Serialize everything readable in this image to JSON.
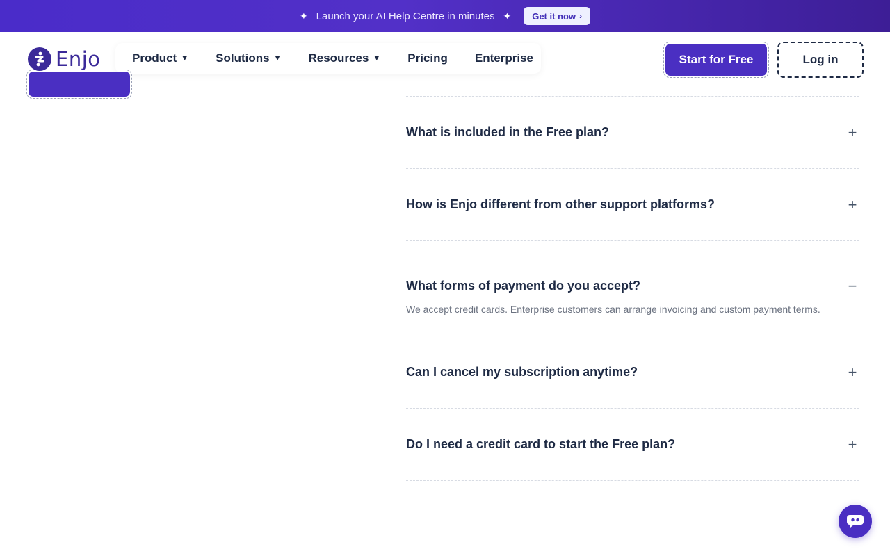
{
  "banner": {
    "text": "Launch your AI Help Centre in minutes",
    "cta_label": "Get it now",
    "cta_icon": "chevron-right-icon",
    "decor_icon": "sparkle-icon"
  },
  "header": {
    "logo_text": "Enjo",
    "nav": [
      {
        "label": "Product",
        "has_dropdown": true
      },
      {
        "label": "Solutions",
        "has_dropdown": true
      },
      {
        "label": "Resources",
        "has_dropdown": true
      },
      {
        "label": "Pricing",
        "has_dropdown": false
      },
      {
        "label": "Enterprise",
        "has_dropdown": false
      }
    ],
    "start_label": "Start for Free",
    "login_label": "Log in"
  },
  "faq": {
    "items": [
      {
        "question": "What is included in the Free plan?",
        "open": false
      },
      {
        "question": "How is Enjo different from other support platforms?",
        "open": false
      },
      {
        "question": "What forms of payment do you accept?",
        "open": true,
        "answer": "We accept credit cards. Enterprise customers can arrange invoicing and custom payment terms."
      },
      {
        "question": "Can I cancel my subscription anytime?",
        "open": false
      },
      {
        "question": "Do I need a credit card to start the Free plan?",
        "open": false
      }
    ]
  },
  "colors": {
    "brand": "#4a2fc2",
    "brand_dark": "#3b2a99",
    "text_dark": "#1e2a44",
    "muted": "#6b7280"
  },
  "chat_widget": {
    "icon": "chat-bubble-icon"
  }
}
